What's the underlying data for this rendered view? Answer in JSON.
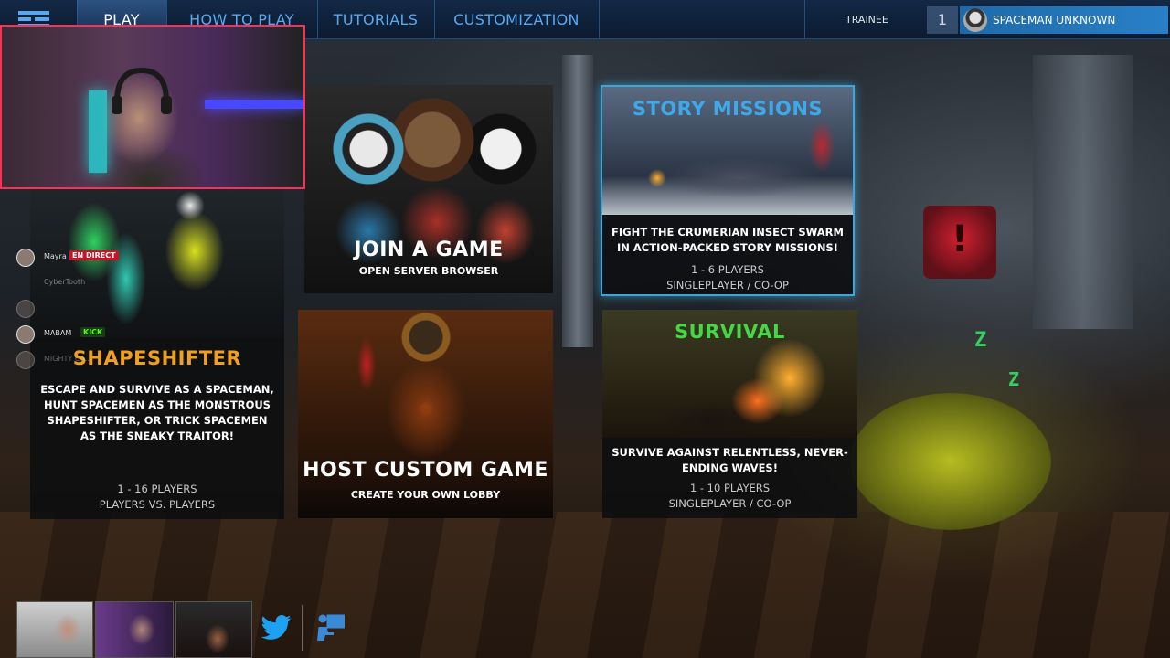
{
  "nav": {
    "items": [
      {
        "label": "PLAY",
        "active": true
      },
      {
        "label": "HOW TO PLAY",
        "active": false
      },
      {
        "label": "TUTORIALS",
        "active": false
      },
      {
        "label": "CUSTOMIZATION",
        "active": false
      }
    ],
    "rank": "TRAINEE",
    "level": "1",
    "player_name": "SPACEMAN UNKNOWN"
  },
  "cards": {
    "join": {
      "title": "JOIN A GAME",
      "subtitle": "OPEN SERVER BROWSER"
    },
    "story": {
      "title": "STORY MISSIONS",
      "description": "FIGHT THE CRUMERIAN INSECT SWARM IN ACTION-PACKED STORY MISSIONS!",
      "players": "1 - 6 PLAYERS",
      "mode": "SINGLEPLAYER / CO-OP"
    },
    "shapeshifter": {
      "title": "SHAPESHIFTER",
      "description": "ESCAPE AND SURVIVE AS A SPACEMAN, HUNT SPACEMEN AS THE MONSTROUS SHAPESHIFTER, OR TRICK SPACEMEN AS THE SNEAKY TRAITOR!",
      "players": "1 - 16 PLAYERS",
      "mode": "PLAYERS VS. PLAYERS"
    },
    "host": {
      "title": "HOST CUSTOM GAME",
      "subtitle": "CREATE YOUR OWN LOBBY"
    },
    "survival": {
      "title": "SURVIVAL",
      "description": "SURVIVE AGAINST RELENTLESS, NEVER-ENDING WAVES!",
      "players": "1 - 10 PLAYERS",
      "mode": "SINGLEPLAYER / CO-OP"
    }
  },
  "chat": {
    "rows": [
      {
        "name": "Mayra",
        "badge": "EN DIRECT"
      },
      {
        "name": "CyberTooth",
        "badge": ""
      },
      {
        "name": "",
        "badge": ""
      },
      {
        "name": "MABAM",
        "badge": "KICK"
      },
      {
        "name": "MIGHTY CA...",
        "badge": ""
      }
    ]
  },
  "decor": {
    "sleep_z_1": "Z",
    "sleep_z_2": "Z",
    "alarm_glyph": "!"
  },
  "colors": {
    "story_title": "#3fa8e8",
    "shapeshifter_title": "#f0a020",
    "survival_title": "#44d844",
    "nav_text": "#58a8f0",
    "selected_border": "#39a6de",
    "webcam_border": "#ff2e54"
  },
  "icons": [
    "logo-icon",
    "twitter-icon",
    "computer-user-icon"
  ]
}
